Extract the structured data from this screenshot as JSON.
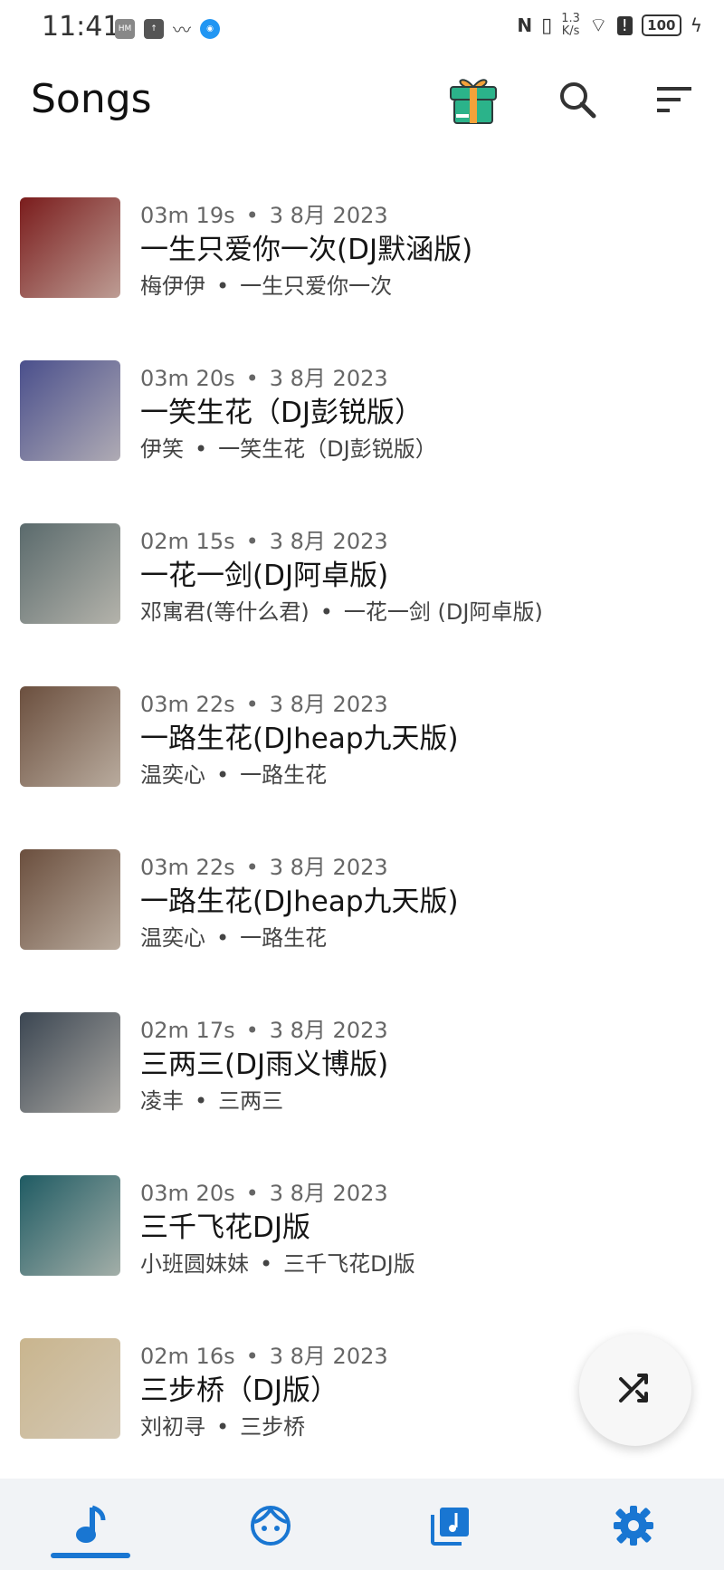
{
  "status_bar": {
    "time": "11:41",
    "network_speed_value": "1.3",
    "network_speed_unit": "K/s",
    "battery": "100"
  },
  "app_bar": {
    "title": "Songs"
  },
  "colors": {
    "accent": "#1976d2",
    "gift_green": "#2bb38a",
    "gift_orange": "#f4a23a"
  },
  "songs": [
    {
      "duration": "03m 19s",
      "date": "3 8月 2023",
      "title": "一生只爱你一次(DJ默涵版)",
      "artist": "梅伊伊",
      "album": "一生只爱你一次",
      "art_color": "#7a1c1c"
    },
    {
      "duration": "03m 20s",
      "date": "3 8月 2023",
      "title": "一笑生花（DJ彭锐版）",
      "artist": "伊笑",
      "album": "一笑生花（DJ彭锐版）",
      "art_color": "#4a4f8c"
    },
    {
      "duration": "02m 15s",
      "date": "3 8月 2023",
      "title": "一花一剑(DJ阿卓版)",
      "artist": "邓寓君(等什么君)",
      "album": "一花一剑 (DJ阿卓版)",
      "art_color": "#5a6a6c"
    },
    {
      "duration": "03m 22s",
      "date": "3 8月 2023",
      "title": "一路生花(DJheap九天版)",
      "artist": "温奕心",
      "album": "一路生花",
      "art_color": "#6b4f3e"
    },
    {
      "duration": "03m 22s",
      "date": "3 8月 2023",
      "title": "一路生花(DJheap九天版)",
      "artist": "温奕心",
      "album": "一路生花",
      "art_color": "#6b4f3e"
    },
    {
      "duration": "02m 17s",
      "date": "3 8月 2023",
      "title": "三两三(DJ雨义博版)",
      "artist": "凌丰",
      "album": "三两三",
      "art_color": "#3b4652"
    },
    {
      "duration": "03m 20s",
      "date": "3 8月 2023",
      "title": "三千飞花DJ版",
      "artist": "小班圆妹妹",
      "album": "三千飞花DJ版",
      "art_color": "#1f5b63"
    },
    {
      "duration": "02m 16s",
      "date": "3 8月 2023",
      "title": "三步桥（DJ版）",
      "artist": "刘初寻",
      "album": "三步桥",
      "art_color": "#c9b58e"
    }
  ],
  "bottom_nav": {
    "items": [
      {
        "icon": "music-note-icon",
        "active": true
      },
      {
        "icon": "artist-face-icon",
        "active": false
      },
      {
        "icon": "album-library-icon",
        "active": false
      },
      {
        "icon": "settings-gear-icon",
        "active": false
      }
    ]
  }
}
